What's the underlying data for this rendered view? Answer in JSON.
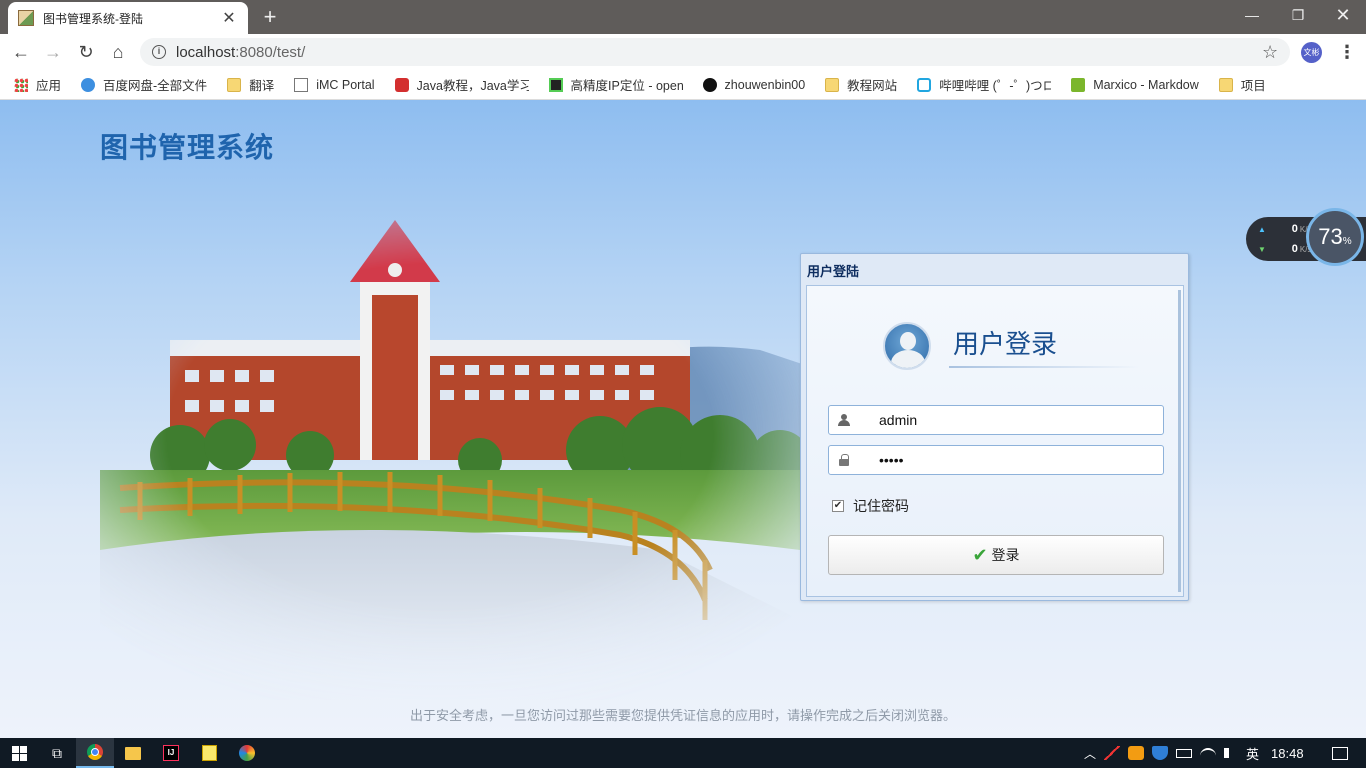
{
  "browser": {
    "tab_title": "图书管理系统-登陆",
    "tab_close": "✕",
    "new_tab": "+",
    "url_host": "localhost",
    "url_rest": ":8080/test/",
    "profile_label": "文彬"
  },
  "bookmarks": [
    {
      "label": "应用",
      "icon": "apps-icon"
    },
    {
      "label": "百度网盘-全部文件",
      "icon": "cloud-icon"
    },
    {
      "label": "翻译",
      "icon": "folder-icon"
    },
    {
      "label": "iMC Portal",
      "icon": "page-icon"
    },
    {
      "label": "Java教程，Java学习",
      "icon": "csdn-icon"
    },
    {
      "label": "高精度IP定位 - open",
      "icon": "ip-icon"
    },
    {
      "label": "zhouwenbin00",
      "icon": "github-icon"
    },
    {
      "label": "教程网站",
      "icon": "folder-icon"
    },
    {
      "label": "哔哩哔哩 (゜-゜)つロ",
      "icon": "bilibili-icon"
    },
    {
      "label": "Marxico - Markdow",
      "icon": "marxico-icon"
    },
    {
      "label": "项目",
      "icon": "folder-icon"
    }
  ],
  "page": {
    "system_title": "图书管理系统",
    "panel_header": "用户登陆",
    "login_heading": "用户登录",
    "username_value": "admin",
    "password_value": "admin",
    "remember_label": "记住密码",
    "remember_checked": true,
    "login_button": "登录",
    "footer_note": "出于安全考虑，一旦您访问过那些需要您提供凭证信息的应用时，请操作完成之后关闭浏览器。"
  },
  "net_widget": {
    "up_value": "0",
    "down_value": "0",
    "unit": "K/s",
    "cpu_value": "73",
    "cpu_unit": "%"
  },
  "taskbar": {
    "ime": "英",
    "time": "18:48"
  },
  "colors": {
    "title_blue": "#1f64ad",
    "panel_border": "#9ab9de",
    "check_green": "#3aa53a"
  }
}
